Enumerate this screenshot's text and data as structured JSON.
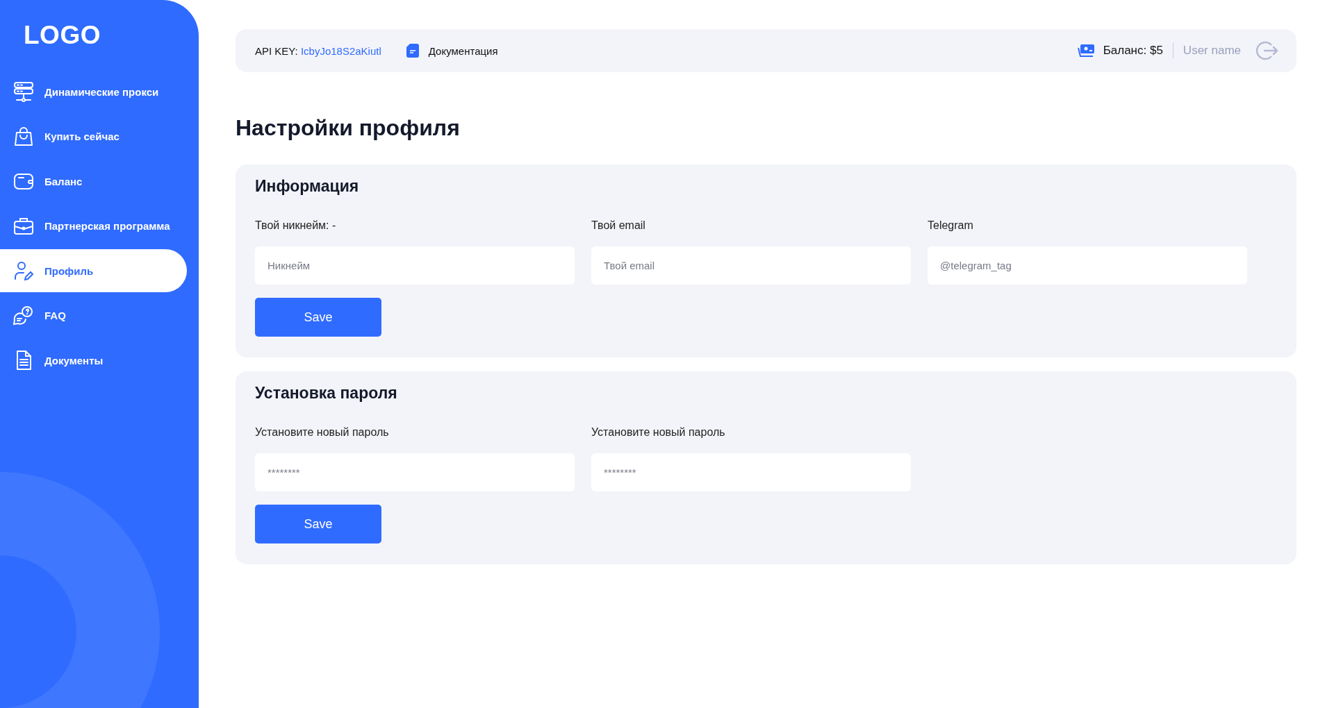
{
  "sidebar": {
    "logo": "LOGO",
    "items": [
      {
        "label": "Динамические прокси",
        "selected": false
      },
      {
        "label": "Купить сейчас",
        "selected": false
      },
      {
        "label": "Баланс",
        "selected": false
      },
      {
        "label": "Партнерская программа",
        "selected": false
      },
      {
        "label": "Профиль",
        "selected": true
      },
      {
        "label": "FAQ",
        "selected": false
      },
      {
        "label": "Документы",
        "selected": false
      }
    ]
  },
  "topbar": {
    "api_key_label": "API KEY:",
    "api_key": "IcbyJo18S2aKiutl",
    "docs_link": "Документация",
    "balance": "Баланс: $5",
    "user_name": "User name"
  },
  "page_title": "Настройки профиля",
  "sections": [
    {
      "title": "Информация",
      "fields": [
        {
          "label": "Твой никнейм: -",
          "placeholder": "Никнейм"
        },
        {
          "label": "Твой email",
          "placeholder": "Твой email"
        },
        {
          "label": "Telegram",
          "placeholder": "@telegram_tag"
        }
      ],
      "button": "Save"
    },
    {
      "title": "Установка пароля",
      "fields": [
        {
          "label": "Установите новый пароль",
          "placeholder": "********"
        },
        {
          "label": "Установите новый пароль",
          "placeholder": "********"
        }
      ],
      "button": "Save"
    }
  ]
}
